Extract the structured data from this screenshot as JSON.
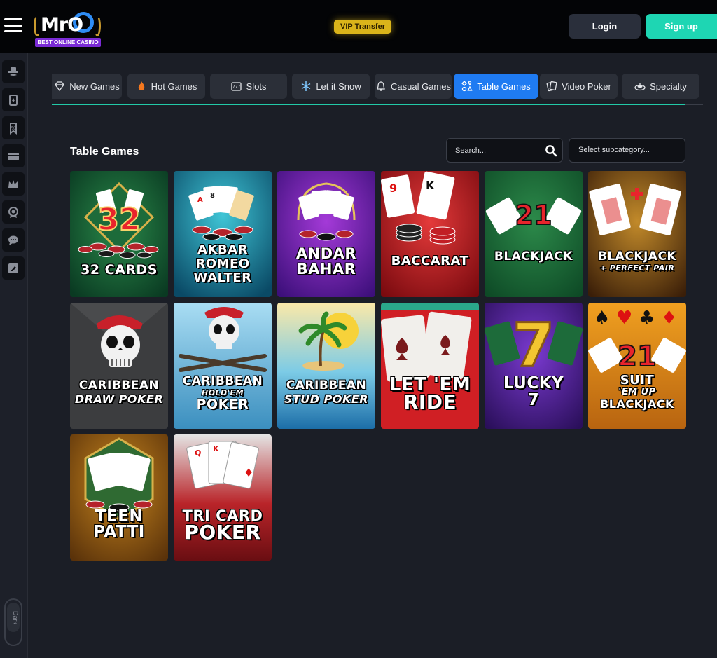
{
  "header": {
    "logo_text": "MrO",
    "logo_tagline": "BEST ONLINE CASINO",
    "vip_label": "VIP Transfer",
    "login_label": "Login",
    "signup_label": "Sign up"
  },
  "sidebar": {
    "items": [
      {
        "icon": "hat-mustache-icon"
      },
      {
        "icon": "card-icon"
      },
      {
        "icon": "discount-tag-icon"
      },
      {
        "icon": "credit-card-icon"
      },
      {
        "icon": "crown-icon"
      },
      {
        "icon": "award-badge-icon"
      },
      {
        "icon": "chat-icon"
      },
      {
        "icon": "edit-note-icon"
      }
    ],
    "theme_toggle_label": "Dark"
  },
  "tabs": [
    {
      "label": "New Games",
      "icon": "diamond-icon",
      "active": false
    },
    {
      "label": "Hot Games",
      "icon": "flame-icon",
      "active": false
    },
    {
      "label": "Slots",
      "icon": "slot-machine-icon",
      "active": false
    },
    {
      "label": "Let it Snow",
      "icon": "snowflake-icon",
      "active": false
    },
    {
      "label": "Casual Games",
      "icon": "bell-icon",
      "active": false
    },
    {
      "label": "Table Games",
      "icon": "table-games-icon",
      "active": true
    },
    {
      "label": "Video Poker",
      "icon": "poker-cards-icon",
      "active": false
    },
    {
      "label": "Specialty",
      "icon": "roulette-icon",
      "active": false
    }
  ],
  "section": {
    "title": "Table Games",
    "search_placeholder": "Search...",
    "subcategory_label": "Select subcategory..."
  },
  "games": [
    {
      "title_lines": [
        "32 CARDS"
      ],
      "badge": "32"
    },
    {
      "title_lines": [
        "AKBAR",
        "ROMEO",
        "WALTER"
      ]
    },
    {
      "title_lines": [
        "ANDAR",
        "BAHAR"
      ]
    },
    {
      "title_lines": [
        "BACCARAT"
      ]
    },
    {
      "title_lines": [
        "BLACKJACK"
      ],
      "badge": "21"
    },
    {
      "title_lines": [
        "BLACKJACK",
        "+ PERFECT PAIR"
      ]
    },
    {
      "title_lines": [
        "CARIBBEAN",
        "DRAW POKER"
      ]
    },
    {
      "title_lines": [
        "CARIBBEAN",
        "HOLD'EM",
        "POKER"
      ]
    },
    {
      "title_lines": [
        "CARIBBEAN",
        "STUD POKER"
      ]
    },
    {
      "title_lines": [
        "LET 'EM",
        "RIDE"
      ]
    },
    {
      "title_lines": [
        "LUCKY",
        "7"
      ],
      "badge": "7"
    },
    {
      "title_lines": [
        "SUIT",
        "'EM UP",
        "BLACKJACK"
      ],
      "badge": "21"
    },
    {
      "title_lines": [
        "TEEN",
        "PATTI"
      ]
    },
    {
      "title_lines": [
        "TRI CARD",
        "POKER"
      ]
    }
  ],
  "colors": {
    "accent_blue": "#1f7bf2",
    "accent_teal": "#1ed6b3",
    "vip_gold": "#dab41a"
  }
}
